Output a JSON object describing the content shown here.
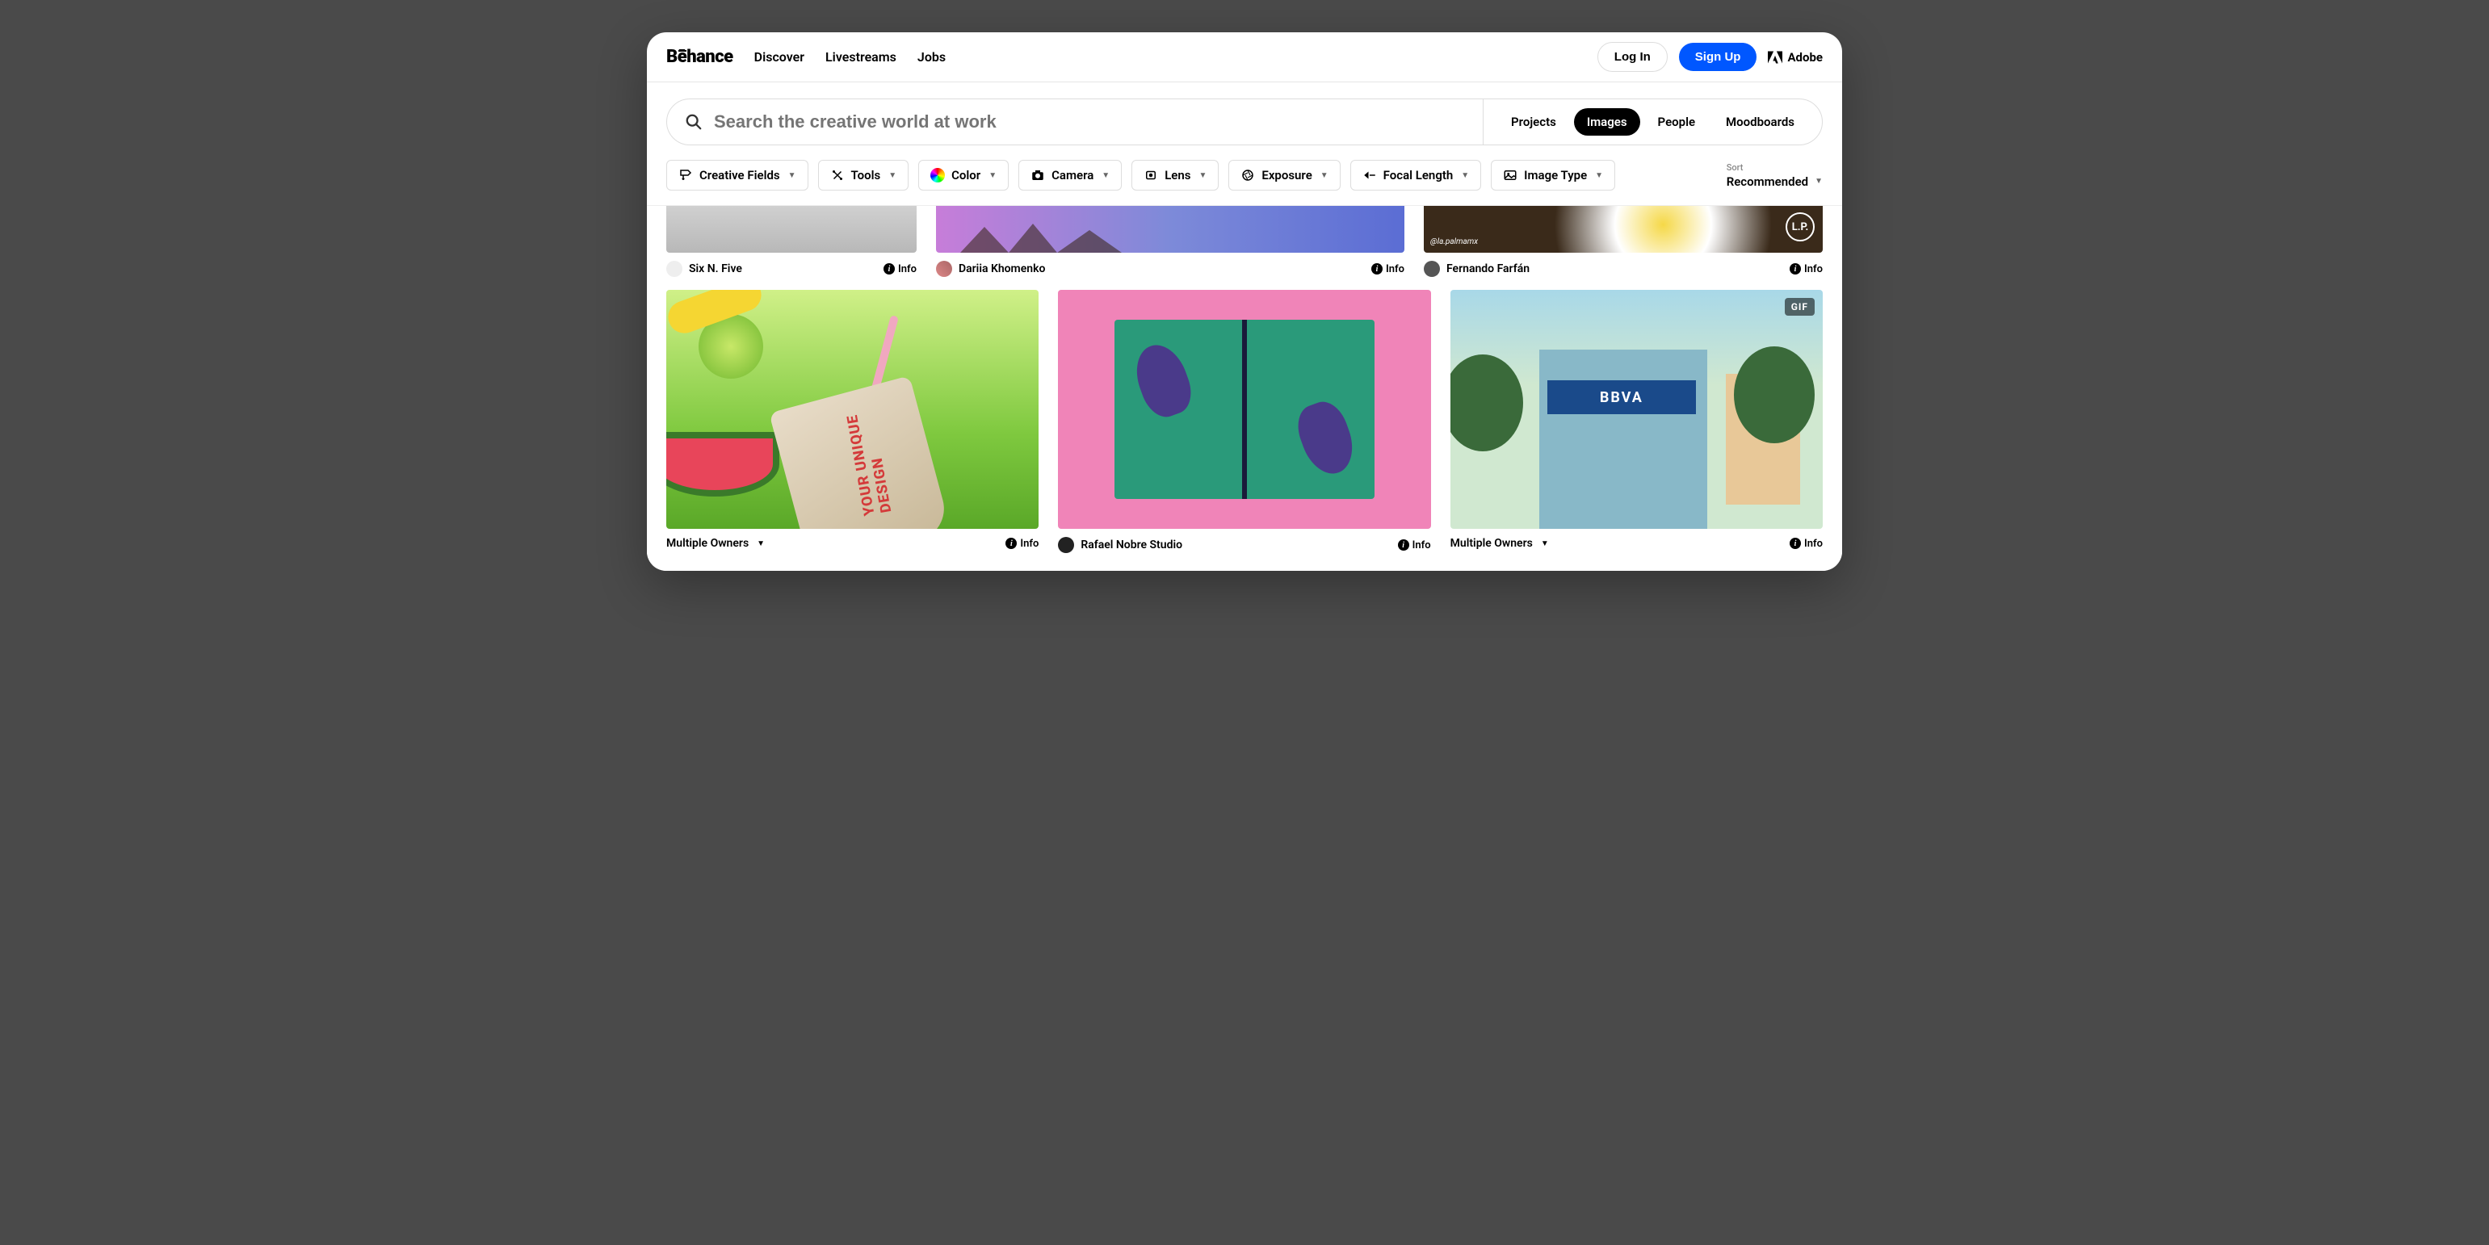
{
  "header": {
    "logo": "Bēhance",
    "nav": {
      "discover": "Discover",
      "livestreams": "Livestreams",
      "jobs": "Jobs"
    },
    "login": "Log In",
    "signup": "Sign Up",
    "adobe": "Adobe"
  },
  "search": {
    "placeholder": "Search the creative world at work",
    "tabs": {
      "projects": "Projects",
      "images": "Images",
      "people": "People",
      "moodboards": "Moodboards"
    }
  },
  "filters": {
    "creative_fields": "Creative Fields",
    "tools": "Tools",
    "color": "Color",
    "camera": "Camera",
    "lens": "Lens",
    "exposure": "Exposure",
    "focal_length": "Focal Length",
    "image_type": "Image Type"
  },
  "sort": {
    "label": "Sort",
    "value": "Recommended"
  },
  "cards_top": [
    {
      "owner": "Six N. Five",
      "info": "Info"
    },
    {
      "owner": "Dariia Khomenko",
      "info": "Info"
    },
    {
      "owner": "Fernando Farfán",
      "info": "Info",
      "watermark": "@la.palmamx",
      "badge": "L.P."
    }
  ],
  "cards_main": [
    {
      "owner": "Multiple Owners",
      "info": "Info",
      "cup_text": "YOUR UNIQUE DESIGN"
    },
    {
      "owner": "Rafael Nobre Studio",
      "info": "Info"
    },
    {
      "owner": "Multiple Owners",
      "info": "Info",
      "gif": "GIF",
      "sign": "BBVA"
    }
  ]
}
